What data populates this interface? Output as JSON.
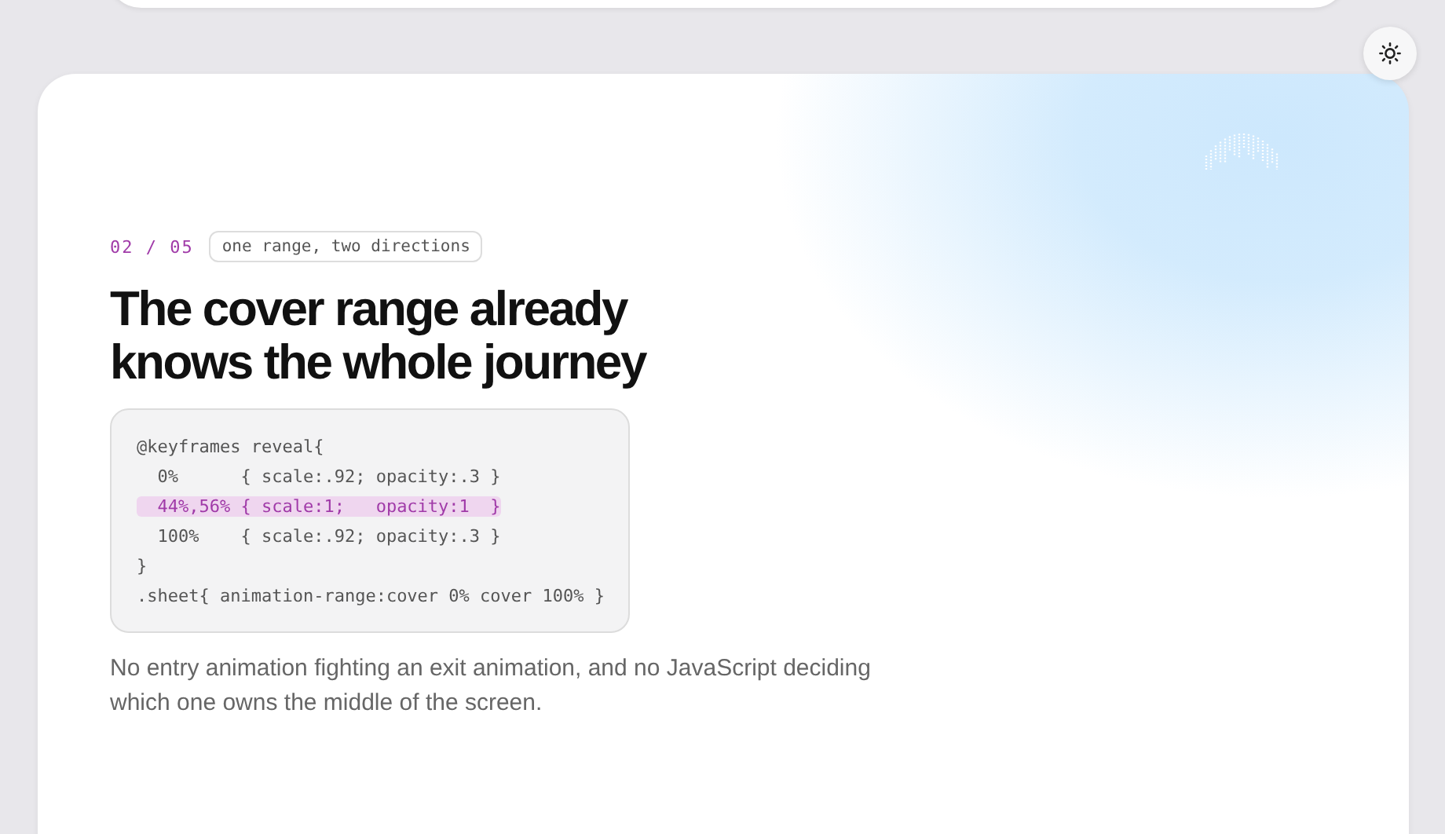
{
  "slide": {
    "counter": "02 / 05",
    "tag": "one range, two directions"
  },
  "heading": "The cover range already knows the whole journey",
  "code_lines": [
    {
      "text": "@keyframes reveal{",
      "highlighted": false
    },
    {
      "text": "  0%      { scale:.92; opacity:.3 }",
      "highlighted": false
    },
    {
      "text": "  44%,56% { scale:1;   opacity:1  }",
      "highlighted": true
    },
    {
      "text": "  100%    { scale:.92; opacity:.3 }",
      "highlighted": false
    },
    {
      "text": "}",
      "highlighted": false
    },
    {
      "text": ".sheet{ animation-range:cover 0% cover 100% }",
      "highlighted": false
    }
  ],
  "body": "No entry animation fighting an exit animation, and no JavaScript deciding which one owns the middle of the screen."
}
